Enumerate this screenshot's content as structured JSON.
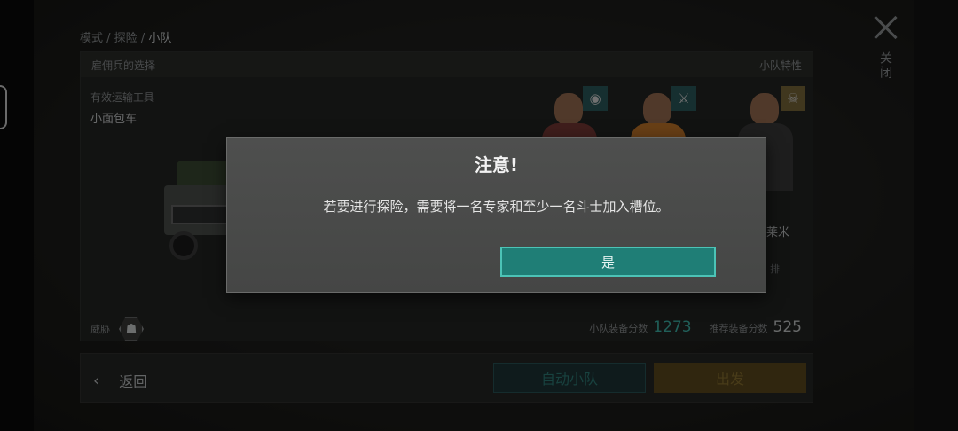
{
  "breadcrumb": {
    "mode": "模式",
    "sep1": " / ",
    "explore": "探险",
    "sep2": " / ",
    "current": "小队"
  },
  "close": {
    "label": "关闭"
  },
  "panel": {
    "left_title": "雇佣兵的选择",
    "right_title": "小队特性",
    "transport_label": "有效运输工具",
    "transport_name": "小面包车",
    "partial_name": "莱米",
    "partial_sub": "排",
    "threat_label": "威胁",
    "threat_icon": "skull-icon",
    "squad_score_label": "小队装备分数",
    "squad_score": "1273",
    "recommended_label": "推荐装备分数",
    "recommended_score": "525"
  },
  "bottom": {
    "back_label": "返回",
    "auto_label": "自动小队",
    "go_label": "出发"
  },
  "modal": {
    "title": "注意!",
    "message": "若要进行探险，需要将一名专家和至少一名斗士加入槽位。",
    "yes_label": "是"
  },
  "colors": {
    "accent_teal": "#1f7e76",
    "score_teal": "#3fb7ab",
    "go_gold": "#5c4a1d"
  }
}
